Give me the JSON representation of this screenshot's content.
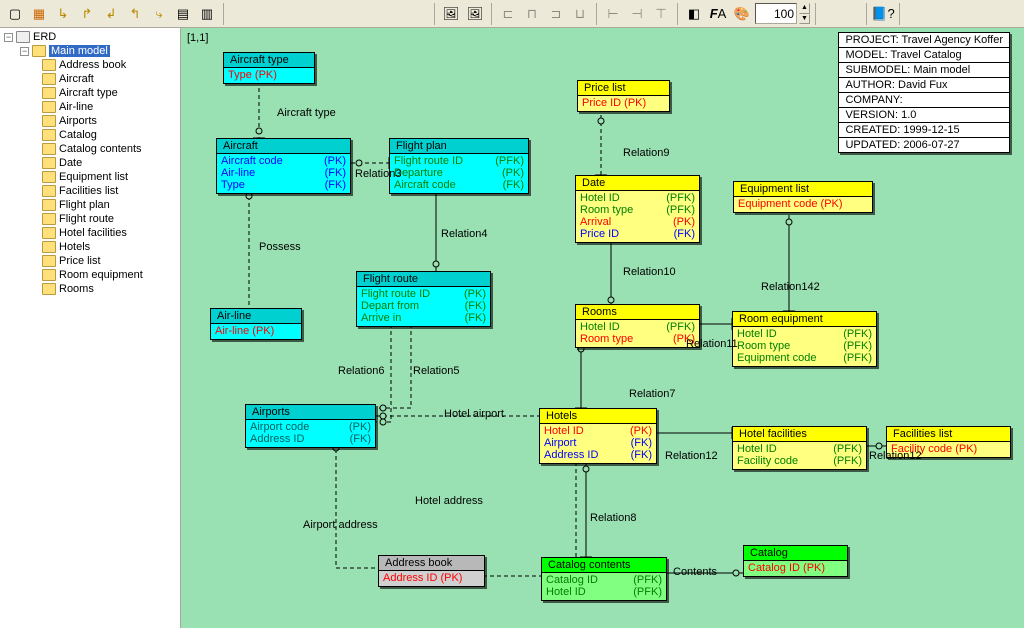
{
  "toolbar": {
    "zoom_value": "100"
  },
  "tree": {
    "root": "ERD",
    "main": "Main model",
    "items": [
      "Address book",
      "Aircraft",
      "Aircraft type",
      "Air-line",
      "Airports",
      "Catalog",
      "Catalog contents",
      "Date",
      "Equipment list",
      "Facilities list",
      "Flight plan",
      "Flight route",
      "Hotel facilities",
      "Hotels",
      "Price list",
      "Room equipment",
      "Rooms"
    ]
  },
  "coord": "[1,1]",
  "meta": {
    "project": "PROJECT: Travel Agency Koffer",
    "model": "MODEL: Travel Catalog",
    "submodel": "SUBMODEL: Main model",
    "author": "AUTHOR: David Fux",
    "company": "COMPANY:",
    "version": "VERSION: 1.0",
    "created": "CREATED: 1999-12-15",
    "updated": "UPDATED: 2006-07-27"
  },
  "entities": {
    "aircraft_type": {
      "title": "Aircraft type",
      "attrs": [
        [
          "Type (PK)",
          "red"
        ]
      ]
    },
    "aircraft": {
      "title": "Aircraft",
      "attrs": [
        [
          "Aircraft code",
          "blue",
          "(PK)"
        ],
        [
          "Air-line",
          "blue",
          "(FK)"
        ],
        [
          "Type",
          "blue",
          "(FK)"
        ]
      ]
    },
    "airline": {
      "title": "Air-line",
      "attrs": [
        [
          "Air-line (PK)",
          "red"
        ]
      ]
    },
    "flight_plan": {
      "title": "Flight plan",
      "attrs": [
        [
          "Flight route ID",
          "green",
          "(PFK)"
        ],
        [
          "Departure",
          "green",
          "(PK)"
        ],
        [
          "Aircraft code",
          "green",
          "(FK)"
        ]
      ]
    },
    "flight_route": {
      "title": "Flight route",
      "attrs": [
        [
          "Flight route ID",
          "green",
          "(PK)"
        ],
        [
          "Depart from",
          "green",
          "(FK)"
        ],
        [
          "Arrive in",
          "green",
          "(FK)"
        ]
      ]
    },
    "airports": {
      "title": "Airports",
      "attrs": [
        [
          "Airport code",
          "dkcyan",
          "(PK)"
        ],
        [
          "Address ID",
          "dkcyan",
          "(FK)"
        ]
      ]
    },
    "address_book": {
      "title": "Address book",
      "attrs": [
        [
          "Address ID (PK)",
          "red"
        ]
      ]
    },
    "price_list": {
      "title": "Price list",
      "attrs": [
        [
          "Price ID (PK)",
          "red"
        ]
      ]
    },
    "date_e": {
      "title": "Date",
      "attrs": [
        [
          "Hotel ID",
          "green",
          "(PFK)"
        ],
        [
          "Room type",
          "green",
          "(PFK)"
        ],
        [
          "Arrival",
          "red",
          "(PK)"
        ],
        [
          "Price ID",
          "blue",
          "(FK)"
        ]
      ]
    },
    "rooms": {
      "title": "Rooms",
      "attrs": [
        [
          "Hotel ID",
          "green",
          "(PFK)"
        ],
        [
          "Room type",
          "red",
          "(PK)"
        ]
      ]
    },
    "hotels": {
      "title": "Hotels",
      "attrs": [
        [
          "Hotel ID",
          "red",
          "(PK)"
        ],
        [
          "Airport",
          "blue",
          "(FK)"
        ],
        [
          "Address ID",
          "blue",
          "(FK)"
        ]
      ]
    },
    "equipment_list": {
      "title": "Equipment list",
      "attrs": [
        [
          "Equipment code (PK)",
          "red"
        ]
      ]
    },
    "room_equipment": {
      "title": "Room equipment",
      "attrs": [
        [
          "Hotel ID",
          "green",
          "(PFK)"
        ],
        [
          "Room type",
          "green",
          "(PFK)"
        ],
        [
          "Equipment code",
          "green",
          "(PFK)"
        ]
      ]
    },
    "hotel_facilities": {
      "title": "Hotel facilities",
      "attrs": [
        [
          "Hotel ID",
          "green",
          "(PFK)"
        ],
        [
          "Facility code",
          "green",
          "(PFK)"
        ]
      ]
    },
    "facilities_list": {
      "title": "Facilities list",
      "attrs": [
        [
          "Facility code (PK)",
          "red"
        ]
      ]
    },
    "catalog_contents": {
      "title": "Catalog contents",
      "attrs": [
        [
          "Catalog ID",
          "green",
          "(PFK)"
        ],
        [
          "Hotel ID",
          "green",
          "(PFK)"
        ]
      ]
    },
    "catalog": {
      "title": "Catalog",
      "attrs": [
        [
          "Catalog ID (PK)",
          "red"
        ]
      ]
    }
  },
  "relations": {
    "aircraft_type": "Aircraft type",
    "relation3": "Relation3",
    "possess": "Possess",
    "relation4": "Relation4",
    "relation5": "Relation5",
    "relation6": "Relation6",
    "hotel_airport": "Hotel airport",
    "airport_address": "Airport address",
    "hotel_address": "Hotel address",
    "relation7": "Relation7",
    "relation8": "Relation8",
    "relation9": "Relation9",
    "relation10": "Relation10",
    "relation11": "Relation11",
    "relation12": "Relation12",
    "relation142": "Relation142",
    "contents": "Contents"
  }
}
